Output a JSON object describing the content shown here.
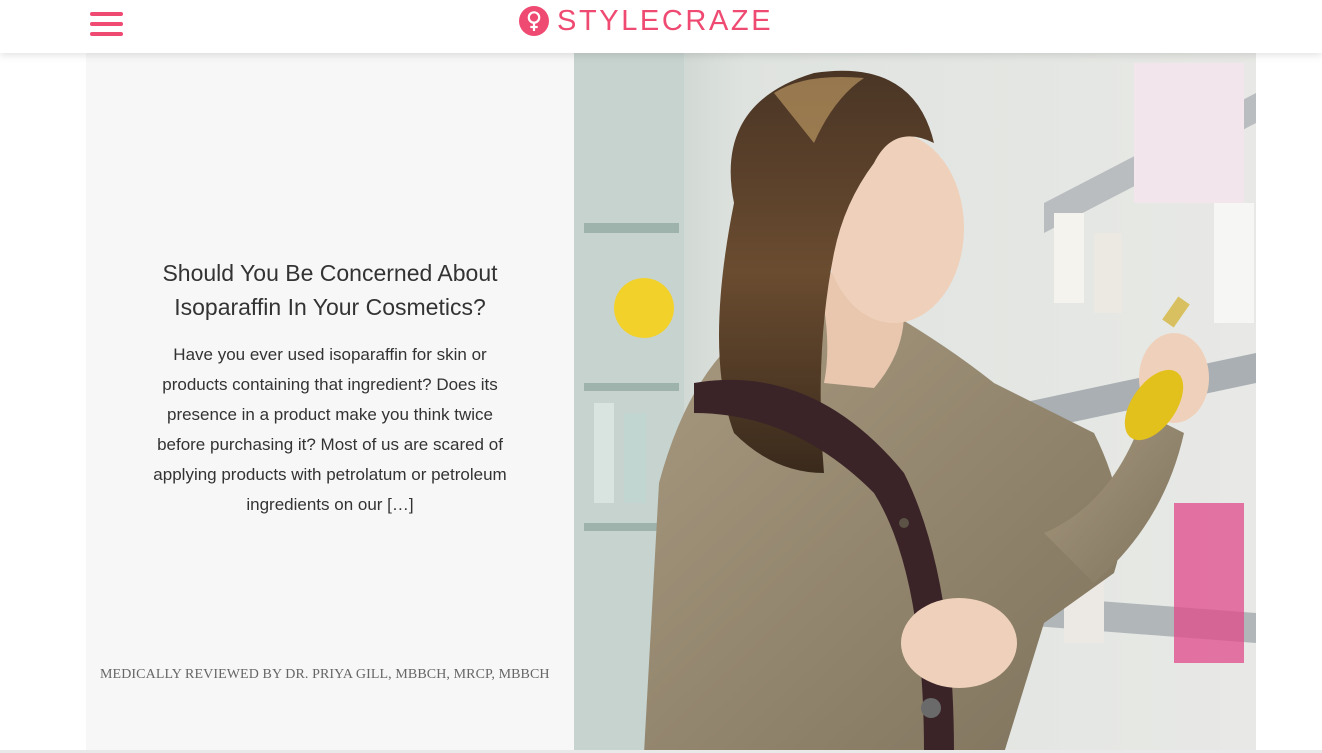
{
  "header": {
    "logo_text": "STYLECRAZE",
    "brand_color": "#ef4a72",
    "menu_icon": "hamburger-menu-icon"
  },
  "article": {
    "title": "Should You Be Concerned About Isoparaffin In Your Cosmetics?",
    "excerpt": "Have you ever used isoparaffin for skin or products containing that ingredient? Does its presence in a product make you think twice before purchasing it? Most of us are scared of applying products with petrolatum or petroleum ingredients on our […]",
    "reviewer": "MEDICALLY REVIEWED BY DR. PRIYA GILL, MBBCH, MRCP, MBBCH"
  }
}
